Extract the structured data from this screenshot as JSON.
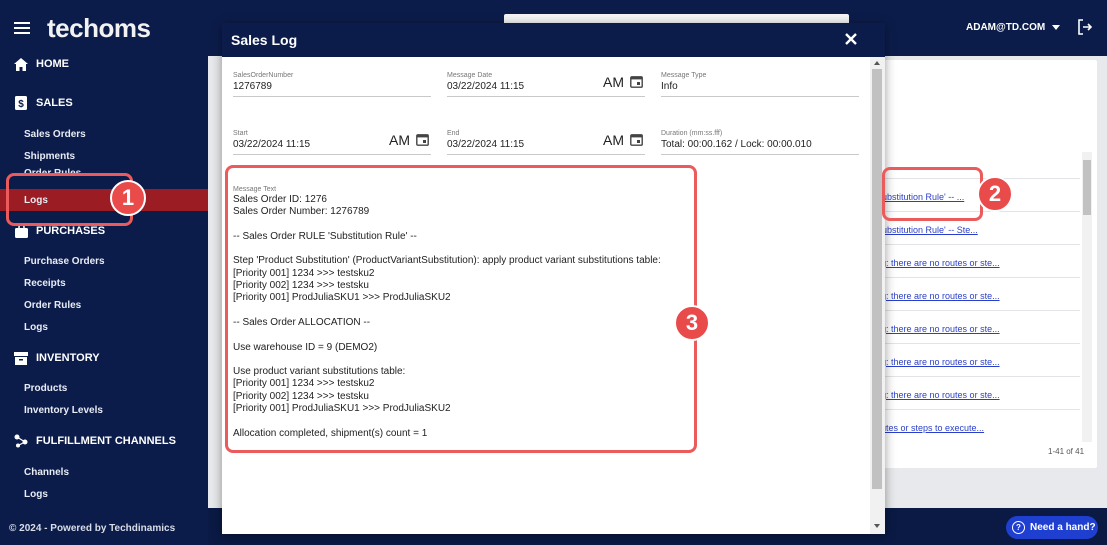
{
  "app": {
    "logo": "techoms",
    "footer": "© 2024 - Powered by Techdinamics"
  },
  "topbar": {
    "user": "ADAM@TD.COM"
  },
  "sidebar": {
    "sections": [
      {
        "label": "HOME",
        "icon": "home-icon"
      },
      {
        "label": "SALES",
        "icon": "dollar-doc-icon"
      },
      {
        "label": "PURCHASES",
        "icon": "bag-icon"
      },
      {
        "label": "INVENTORY",
        "icon": "inventory-icon"
      },
      {
        "label": "FULFILLMENT CHANNELS",
        "icon": "channels-icon"
      }
    ],
    "sales_items": [
      "Sales Orders",
      "Shipments",
      "Order Rules",
      "Logs"
    ],
    "purchase_items": [
      "Purchase Orders",
      "Receipts",
      "Order Rules",
      "Logs"
    ],
    "inventory_items": [
      "Products",
      "Inventory Levels"
    ],
    "fulfillment_items": [
      "Channels",
      "Logs"
    ]
  },
  "background_list": {
    "links": [
      "Substitution Rule' -- ...",
      "Substitution Rule' -- Ste...",
      "ng: there are no routes or ste...",
      "ng: there are no routes or ste...",
      "ng: there are no routes or ste...",
      "ng: there are no routes or ste...",
      "ng: there are no routes or ste...",
      "ng: there are no routes or ste...",
      "outes or steps to execute..."
    ],
    "pager": "1-41 of 41"
  },
  "help_button": "Need a hand?",
  "modal": {
    "title": "Sales Log",
    "fields": {
      "sales_order_number": {
        "label": "SalesOrderNumber",
        "value": "1276789"
      },
      "message_date": {
        "label": "Message Date",
        "value": "03/22/2024 11:15",
        "ampm": "AM"
      },
      "message_type": {
        "label": "Message Type",
        "value": "Info"
      },
      "start": {
        "label": "Start",
        "value": "03/22/2024 11:15",
        "ampm": "AM"
      },
      "end": {
        "label": "End",
        "value": "03/22/2024 11:15",
        "ampm": "AM"
      },
      "duration": {
        "label": "Duration (mm:ss.fff)",
        "value": "Total: 00:00.162 / Lock: 00:00.010"
      }
    },
    "message_label": "Message Text",
    "message_lines": [
      "Sales Order ID: 1276",
      "Sales Order Number: 1276789",
      "",
      "-- Sales Order RULE 'Substitution Rule' --",
      "",
      "Step 'Product Substitution' (ProductVariantSubstitution): apply product variant substitutions table:",
      "[Priority 001] 1234 >>> testsku2",
      "[Priority 002] 1234 >>> testsku",
      "[Priority 001] ProdJuliaSKU1 >>> ProdJuliaSKU2",
      "",
      "-- Sales Order ALLOCATION --",
      "",
      "Use warehouse ID = 9 (DEMO2)",
      "",
      "Use product variant substitutions table:",
      "[Priority 001] 1234 >>> testsku2",
      "[Priority 002] 1234 >>> testsku",
      "[Priority 001] ProdJuliaSKU1 >>> ProdJuliaSKU2",
      "",
      "Allocation completed, shipment(s) count = 1"
    ]
  },
  "callouts": [
    "1",
    "2",
    "3"
  ],
  "colors": {
    "navy": "#0c1c4a",
    "active": "#9b1c22",
    "callout": "#e94b4b",
    "link": "#2a3fc9"
  }
}
